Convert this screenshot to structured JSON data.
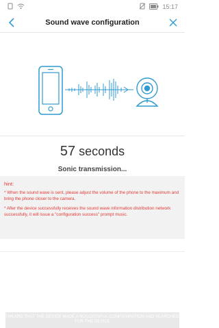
{
  "status_bar": {
    "time": "15:17",
    "left_icons": [
      "sim-card-icon",
      "wifi-icon"
    ],
    "right_icons": [
      "no-sim-icon",
      "battery-icon"
    ]
  },
  "nav": {
    "title": "Sound wave configuration",
    "back_icon": "chevron-left-icon",
    "close_icon": "close-icon"
  },
  "timer": {
    "value": "57",
    "unit": "seconds"
  },
  "status_text": "Sonic transmission...",
  "hint": {
    "title": "hint:",
    "items": [
      "* When the sound wave is sent, please adjust the volume of the phone to the maximum and bring the phone closer to the camera.",
      "* After the device successfully receives the sound wave information distribution network successfully, it will issue a \"configuration success\" prompt music."
    ]
  },
  "bottom_button": {
    "label": "I HEARD THAT THE DEVICE MADE A SUCCESSFUL CONFIGURATION AND SEARCHED FOR THE DEVICE"
  },
  "colors": {
    "accent": "#2f9bd1",
    "hint_text": "#e53935",
    "hint_bg": "#f2f2f2"
  }
}
